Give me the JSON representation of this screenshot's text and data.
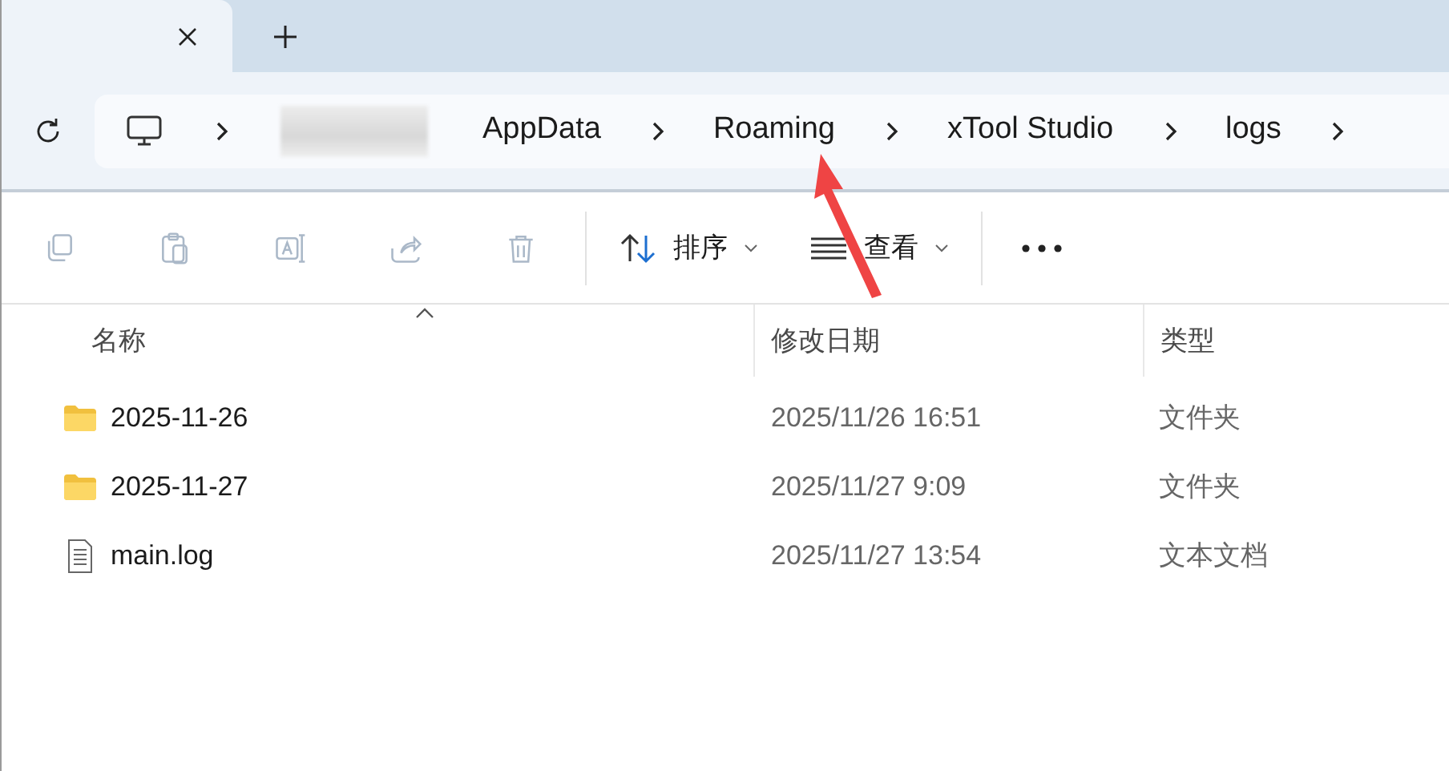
{
  "tabs": [
    {
      "selected": true
    },
    {
      "selected": false,
      "kind": "new"
    }
  ],
  "breadcrumbs": [
    "AppData",
    "Roaming",
    "xTool Studio",
    "logs"
  ],
  "toolbar": {
    "actions": [
      {
        "kind": "copy",
        "disabled": true
      },
      {
        "kind": "paste",
        "disabled": true
      },
      {
        "kind": "rename",
        "disabled": true
      },
      {
        "kind": "share",
        "disabled": true
      },
      {
        "kind": "delete",
        "disabled": true
      }
    ],
    "sort": "排序",
    "view": "查看"
  },
  "columns": [
    {
      "label": "名称",
      "sorted": true
    },
    {
      "label": "修改日期",
      "sorted": false
    },
    {
      "label": "类型",
      "sorted": false
    }
  ],
  "rows": [
    {
      "kind": "folder",
      "name": "2025-11-26",
      "date": "2025/11/26 16:51",
      "type": "文件夹"
    },
    {
      "kind": "folder",
      "name": "2025-11-27",
      "date": "2025/11/27 9:09",
      "type": "文件夹"
    },
    {
      "kind": "file",
      "name": "main.log",
      "date": "2025/11/27 13:54",
      "type": "文本文档"
    }
  ]
}
